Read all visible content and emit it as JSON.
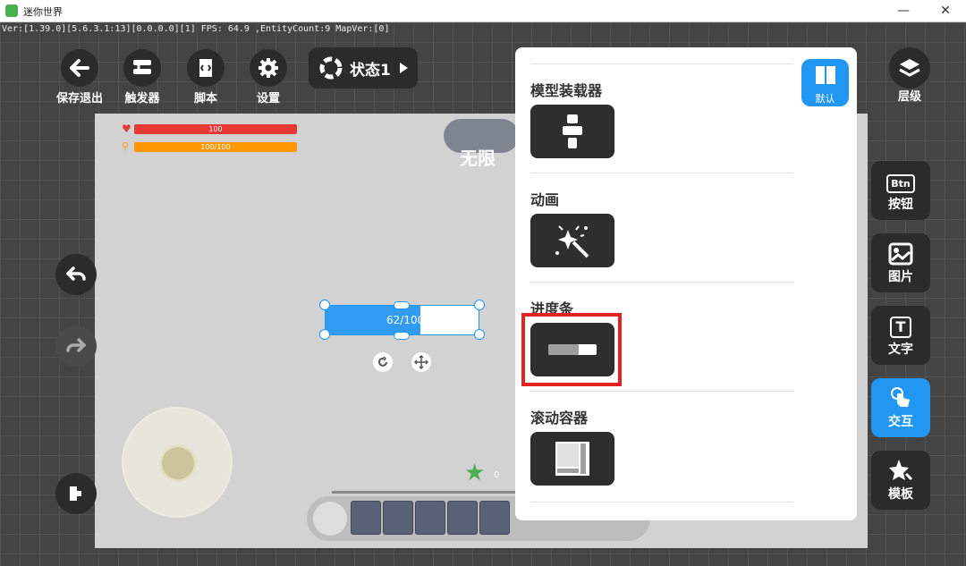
{
  "window": {
    "title": "迷你世界",
    "min": "—",
    "max": "☐",
    "close": "✕"
  },
  "debug_text": "Ver:[1.39.0][5.6.3.1:13][0.0.0.0][1] FPS: 64.9   ,EntityCount:9   MapVer:[0]",
  "toolbar": {
    "save_exit": "保存退出",
    "trigger": "触发器",
    "script": "脚本",
    "settings": "设置",
    "state": "状态1",
    "layers": "层级"
  },
  "canvas": {
    "health": {
      "label": "100",
      "value": 1.0
    },
    "hunger": {
      "label": "100/100",
      "value": 1.0
    },
    "infinite": "无限",
    "progress_widget": {
      "label": "62/100",
      "value": 0.62
    },
    "star_count": "0"
  },
  "popup": {
    "default_label": "默认",
    "sections": [
      {
        "title": "模型装载器"
      },
      {
        "title": "动画"
      },
      {
        "title": "进度条"
      },
      {
        "title": "滚动容器"
      }
    ]
  },
  "right_panel": {
    "button_icon_text": "Btn",
    "button": "按钮",
    "image": "图片",
    "text_icon": "T",
    "text": "文字",
    "interact": "交互",
    "template": "模板"
  },
  "colors": {
    "accent": "#2196f3",
    "health": "#e53935",
    "hunger": "#ff9800",
    "highlight": "#e52222"
  }
}
